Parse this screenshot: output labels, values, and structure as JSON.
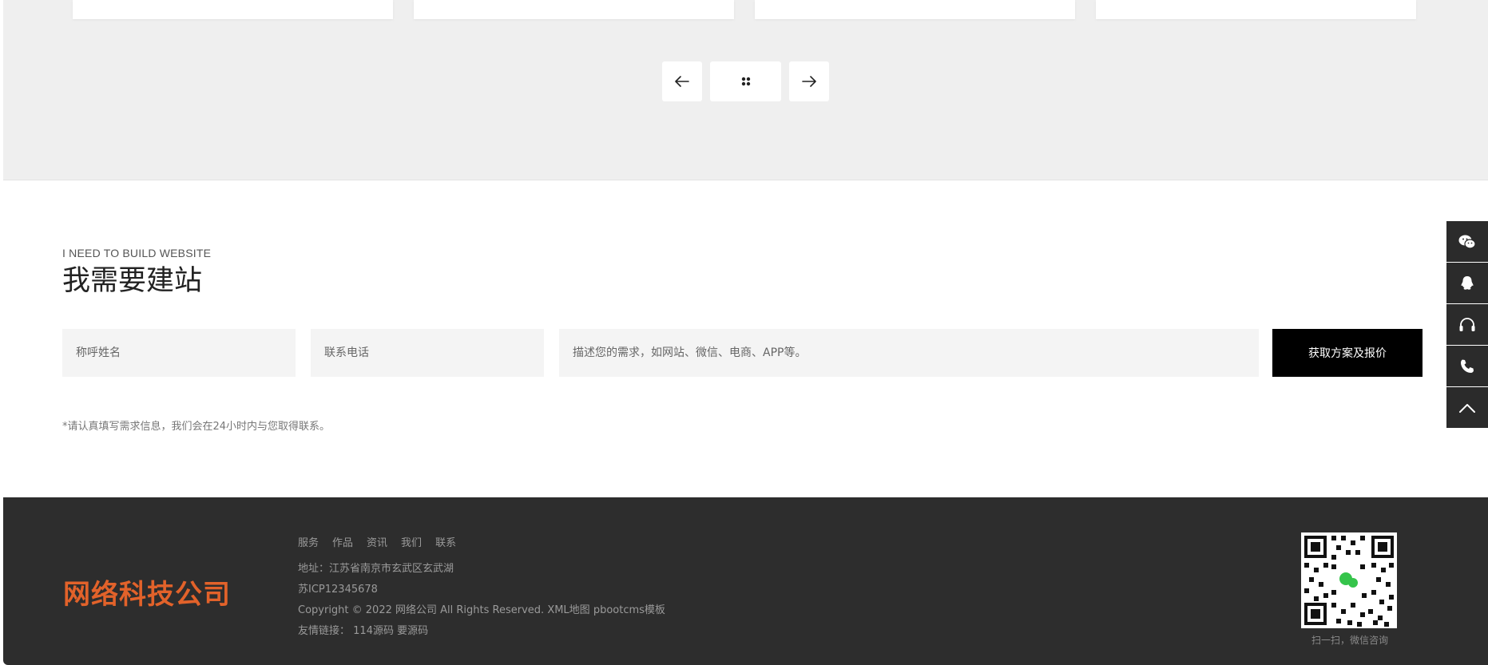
{
  "pager": {
    "prev_icon": "arrow-left-icon",
    "grid_icon": "grid-dots-icon",
    "next_icon": "arrow-right-icon"
  },
  "build": {
    "subtitle": "I NEED TO BUILD WEBSITE",
    "title": "我需要建站",
    "name_placeholder": "称呼姓名",
    "phone_placeholder": "联系电话",
    "desc_placeholder": "描述您的需求，如网站、微信、电商、APP等。",
    "submit_label": "获取方案及报价",
    "note": "*请认真填写需求信息，我们会在24小时内与您取得联系。"
  },
  "footer": {
    "logo": "网络科技公司",
    "nav": [
      "服务",
      "作品",
      "资讯",
      "我们",
      "联系"
    ],
    "address": "地址：江苏省南京市玄武区玄武湖",
    "icp": "苏ICP12345678",
    "copyright": "Copyright © 2022 网络公司 All Rights Reserved.",
    "xml_map": "XML地图",
    "template": "pbootcms模板",
    "links_label": "友情链接：",
    "links": [
      "114源码",
      "要源码"
    ],
    "qr_caption": "扫一扫，微信咨询"
  },
  "sidebar": {
    "icons": [
      "wechat-icon",
      "qq-icon",
      "headset-icon",
      "phone-icon",
      "chevron-up-icon"
    ]
  },
  "colors": {
    "logo": "#e2622a",
    "footer_bg": "#2d2d2d",
    "top_bg": "#efefef",
    "submit_bg": "#000000",
    "sidebar_bg": "#2b2b2b"
  }
}
